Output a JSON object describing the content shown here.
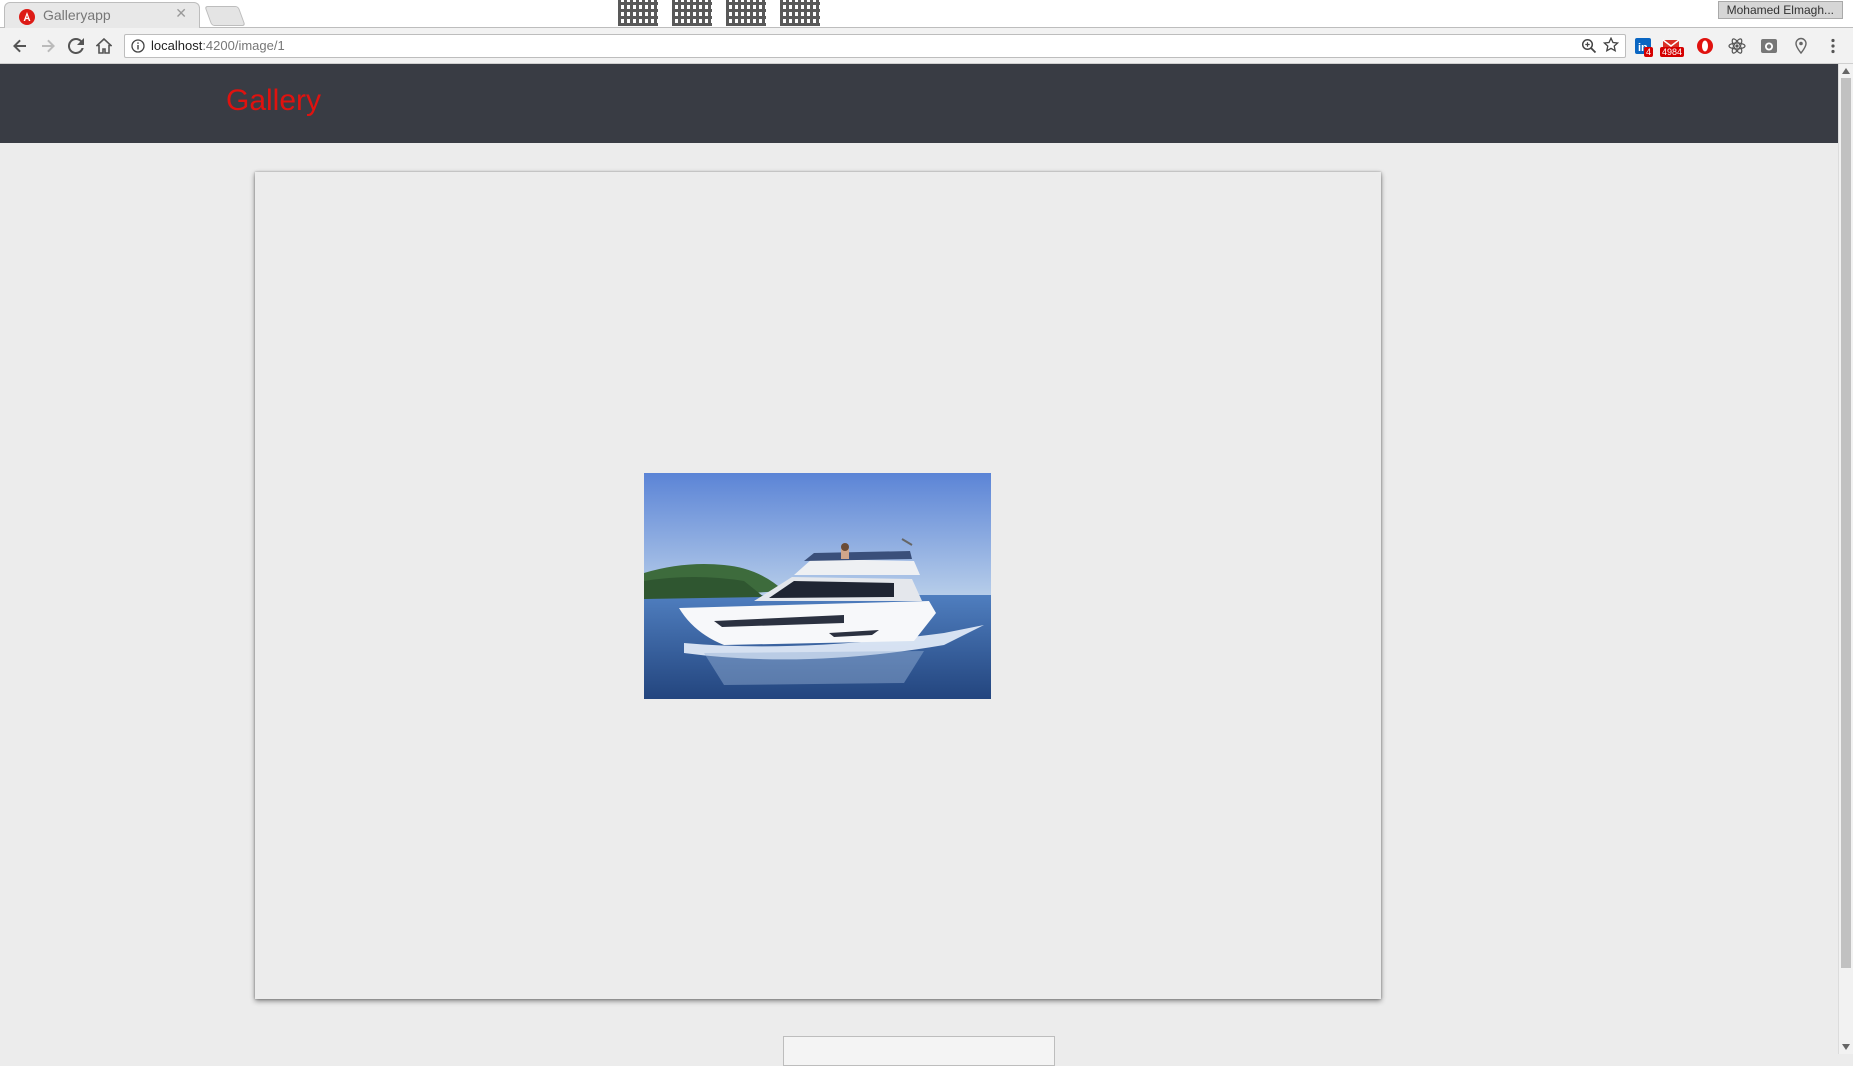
{
  "browser": {
    "tab": {
      "title": "Galleryapp",
      "close_icon": "close-icon"
    },
    "profile_name": "Mohamed Elmagh...",
    "url": {
      "host": "localhost",
      "rest": ":4200/image/1"
    },
    "extensions": [
      {
        "name": "linkedin-icon",
        "badge": "4"
      },
      {
        "name": "mail-icon",
        "badge": "4984"
      },
      {
        "name": "opera-icon",
        "badge": ""
      },
      {
        "name": "react-icon",
        "badge": ""
      },
      {
        "name": "camera-icon",
        "badge": ""
      },
      {
        "name": "location-icon",
        "badge": ""
      }
    ]
  },
  "app": {
    "title": "Gallery",
    "accent_color": "#e0120f",
    "header_color": "#393c44"
  }
}
